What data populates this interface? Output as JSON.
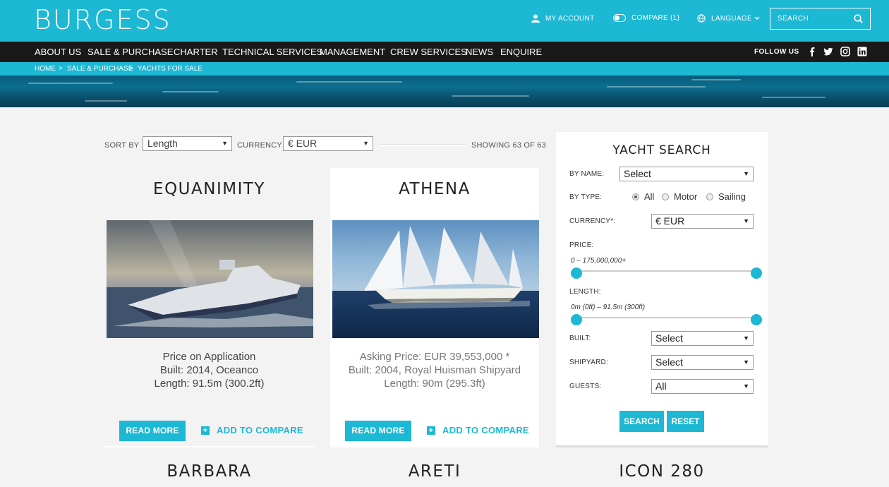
{
  "header": {
    "logo": "BURGESS",
    "my_account": "MY ACCOUNT",
    "compare": "COMPARE (1)",
    "language": "LANGUAGE",
    "search_placeholder": "SEARCH"
  },
  "nav": {
    "items": [
      "ABOUT US",
      "SALE & PURCHASE",
      "CHARTER",
      "TECHNICAL SERVICES",
      "MANAGEMENT",
      "CREW SERVICES",
      "NEWS",
      "ENQUIRE"
    ],
    "follow_us": "FOLLOW US"
  },
  "breadcrumb": [
    "HOME",
    ">",
    "SALE & PURCHASE",
    ">",
    "YACHTS FOR SALE"
  ],
  "toolbar": {
    "sort_label": "SORT BY",
    "sort_value": "Length",
    "currency_label": "CURRENCY",
    "currency_value": "€ EUR",
    "showing": "SHOWING 63 OF 63"
  },
  "yachts": [
    {
      "name": "EQUANIMITY",
      "price": "Price on Application",
      "built": "Built: 2014, Oceanco",
      "length": "Length: 91.5m (300.2ft)",
      "read_more": "READ MORE",
      "add_compare": "ADD TO COMPARE"
    },
    {
      "name": "ATHENA",
      "price": "Asking Price: EUR 39,553,000 *",
      "built": "Built: 2004, Royal Huisman Shipyard",
      "length": "Length: 90m (295.3ft)",
      "read_more": "READ MORE",
      "add_compare": "ADD TO COMPARE"
    }
  ],
  "next_row": [
    "BARBARA",
    "ARETI",
    "ICON 280"
  ],
  "search_panel": {
    "title": "YACHT SEARCH",
    "by_name_label": "BY NAME:",
    "by_name_value": "Select",
    "by_type_label": "BY TYPE:",
    "types": [
      "All",
      "Motor",
      "Sailing"
    ],
    "selected_type": "All",
    "currency_label": "CURRENCY*:",
    "currency_value": "€ EUR",
    "price_label": "PRICE:",
    "price_range": "0 – 175,000,000+",
    "length_label": "LENGTH:",
    "length_range": "0m (0ft) – 91.5m (300ft)",
    "built_label": "BUILT:",
    "built_value": "Select",
    "shipyard_label": "SHIPYARD:",
    "shipyard_value": "Select",
    "guests_label": "GUESTS:",
    "guests_value": "All",
    "search_button": "SEARCH",
    "reset_button": "RESET"
  },
  "colors": {
    "accent": "#1cb8d4",
    "navbar": "#191919",
    "background": "#f3f3f3"
  }
}
